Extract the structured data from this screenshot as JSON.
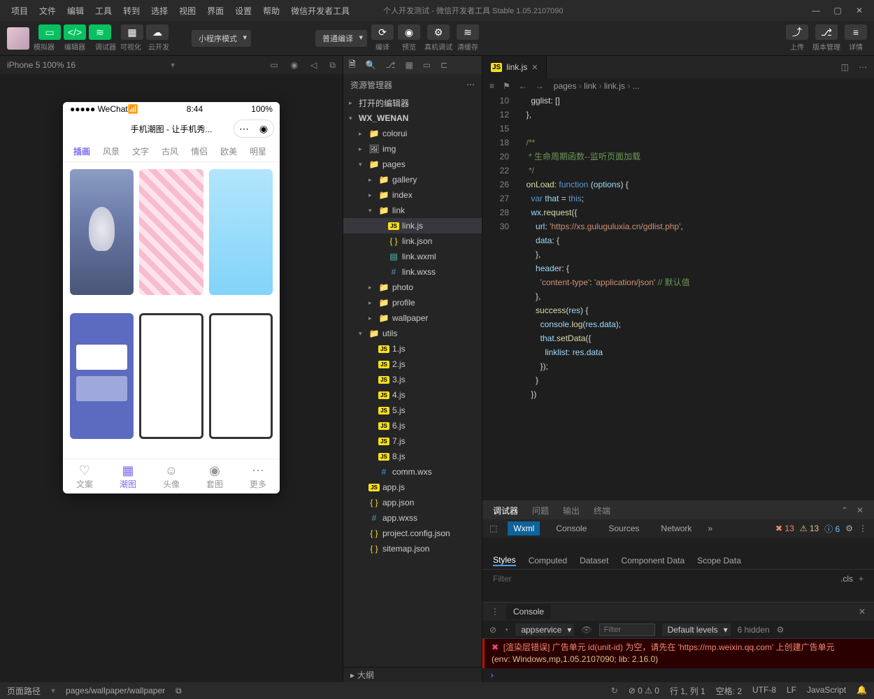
{
  "titlebar": {
    "menus": [
      "项目",
      "文件",
      "编辑",
      "工具",
      "转到",
      "选择",
      "视图",
      "界面",
      "设置",
      "帮助",
      "微信开发者工具"
    ],
    "title": "个人开发测试 - 微信开发者工具 Stable 1.05.2107090"
  },
  "toolbar": {
    "groups": {
      "g1": [
        "模拟器",
        "编辑器",
        "调试器"
      ],
      "g2": [
        "可视化",
        "云开发"
      ],
      "mode_select": "小程序模式",
      "compile_select": "普通编译",
      "compile": "编译",
      "preview": "预览",
      "remote": "真机调试",
      "cache": "清缓存",
      "upload": "上传",
      "version": "版本管理",
      "details": "详情"
    }
  },
  "simulator": {
    "device": "iPhone 5 100% 16",
    "status": {
      "carrier": "●●●●● WeChat",
      "wifi": "📶",
      "time": "8:44",
      "battery": "100%"
    },
    "app_title": "手机潮图 - 让手机秀...",
    "tabs": [
      "插画",
      "风景",
      "文字",
      "古风",
      "情侣",
      "欧美",
      "明星"
    ],
    "nav": [
      {
        "icon": "♡",
        "label": "文案"
      },
      {
        "icon": "▦",
        "label": "潮图"
      },
      {
        "icon": "☺",
        "label": "头像"
      },
      {
        "icon": "◉",
        "label": "套图"
      },
      {
        "icon": "⋯",
        "label": "更多"
      }
    ]
  },
  "explorer": {
    "title": "资源管理器",
    "open_editors": "打开的编辑器",
    "project": "WX_WENAN",
    "tree": [
      {
        "indent": 22,
        "chev": "▸",
        "icon": "folder",
        "label": "colorui"
      },
      {
        "indent": 22,
        "chev": "▸",
        "icon": "img",
        "label": "img"
      },
      {
        "indent": 22,
        "chev": "▾",
        "icon": "folder",
        "label": "pages"
      },
      {
        "indent": 36,
        "chev": "▸",
        "icon": "folder",
        "label": "gallery"
      },
      {
        "indent": 36,
        "chev": "▸",
        "icon": "folder",
        "label": "index"
      },
      {
        "indent": 36,
        "chev": "▾",
        "icon": "folder",
        "label": "link"
      },
      {
        "indent": 50,
        "chev": "",
        "icon": "js",
        "label": "link.js",
        "selected": true
      },
      {
        "indent": 50,
        "chev": "",
        "icon": "json",
        "label": "link.json"
      },
      {
        "indent": 50,
        "chev": "",
        "icon": "wxml",
        "label": "link.wxml"
      },
      {
        "indent": 50,
        "chev": "",
        "icon": "wxss",
        "label": "link.wxss"
      },
      {
        "indent": 36,
        "chev": "▸",
        "icon": "folder",
        "label": "photo"
      },
      {
        "indent": 36,
        "chev": "▸",
        "icon": "folder",
        "label": "profile"
      },
      {
        "indent": 36,
        "chev": "▸",
        "icon": "folder",
        "label": "wallpaper"
      },
      {
        "indent": 22,
        "chev": "▾",
        "icon": "folder",
        "label": "utils"
      },
      {
        "indent": 36,
        "chev": "",
        "icon": "js",
        "label": "1.js"
      },
      {
        "indent": 36,
        "chev": "",
        "icon": "js",
        "label": "2.js"
      },
      {
        "indent": 36,
        "chev": "",
        "icon": "js",
        "label": "3.js"
      },
      {
        "indent": 36,
        "chev": "",
        "icon": "js",
        "label": "4.js"
      },
      {
        "indent": 36,
        "chev": "",
        "icon": "js",
        "label": "5.js"
      },
      {
        "indent": 36,
        "chev": "",
        "icon": "js",
        "label": "6.js"
      },
      {
        "indent": 36,
        "chev": "",
        "icon": "js",
        "label": "7.js"
      },
      {
        "indent": 36,
        "chev": "",
        "icon": "js",
        "label": "8.js"
      },
      {
        "indent": 36,
        "chev": "",
        "icon": "wxss",
        "label": "comm.wxs"
      },
      {
        "indent": 22,
        "chev": "",
        "icon": "js",
        "label": "app.js"
      },
      {
        "indent": 22,
        "chev": "",
        "icon": "json",
        "label": "app.json"
      },
      {
        "indent": 22,
        "chev": "",
        "icon": "wxss",
        "label": "app.wxss"
      },
      {
        "indent": 22,
        "chev": "",
        "icon": "json",
        "label": "project.config.json"
      },
      {
        "indent": 22,
        "chev": "",
        "icon": "json",
        "label": "sitemap.json"
      }
    ],
    "outline": "大纲"
  },
  "editor": {
    "tab": "link.js",
    "breadcrumb": [
      "pages",
      "link",
      "link.js",
      "..."
    ],
    "code": {
      "lines": [
        {
          "n": "",
          "html": "    gglist: []"
        },
        {
          "n": "10",
          "html": "  },"
        },
        {
          "n": "",
          "html": ""
        },
        {
          "n": "12",
          "html": "  <span class=c-green>/**</span>"
        },
        {
          "n": "",
          "html": "<span class=c-green>   * 生命周期函数--监听页面加载</span>"
        },
        {
          "n": "",
          "html": "<span class=c-green>   */</span>"
        },
        {
          "n": "15",
          "html": "  <span class=c-yellow>onLoad</span>: <span class=c-blue>function</span> (<span class=c-lblue>options</span>) {"
        },
        {
          "n": "",
          "html": "    <span class=c-blue>var</span> <span class=c-lblue>that</span> = <span class=c-blue>this</span>;"
        },
        {
          "n": "",
          "html": "    <span class=c-lblue>wx</span>.<span class=c-yellow>request</span>({"
        },
        {
          "n": "18",
          "html": "      <span class=c-lblue>url</span>: <span class=c-orange>'https://xs.guluguluxia.cn/gdlist.php'</span>,"
        },
        {
          "n": "",
          "html": "      <span class=c-lblue>data</span>: {"
        },
        {
          "n": "20",
          "html": "      },"
        },
        {
          "n": "",
          "html": "      <span class=c-lblue>header</span>: {"
        },
        {
          "n": "22",
          "html": "        <span class=c-orange>'content-type'</span>: <span class=c-orange>'application/json'</span> <span class=c-green>// 默认值</span>"
        },
        {
          "n": "",
          "html": "      },"
        },
        {
          "n": "",
          "html": "      <span class=c-yellow>success</span>(<span class=c-lblue>res</span>) {"
        },
        {
          "n": "",
          "html": "        <span class=c-lblue>console</span>.<span class=c-yellow>log</span>(<span class=c-lblue>res</span>.<span class=c-lblue>data</span>);"
        },
        {
          "n": "26",
          "html": "        <span class=c-lblue>that</span>.<span class=c-yellow>setData</span>({"
        },
        {
          "n": "27",
          "html": "          <span class=c-lblue>linklist</span>: <span class=c-lblue>res</span>.<span class=c-lblue>data</span>"
        },
        {
          "n": "28",
          "html": "        });"
        },
        {
          "n": "",
          "html": "      }"
        },
        {
          "n": "30",
          "html": "    })"
        }
      ]
    }
  },
  "debugger": {
    "tabs": [
      "调试器",
      "问题",
      "输出",
      "终端"
    ],
    "tools": [
      "Wxml",
      "Console",
      "Sources",
      "Network"
    ],
    "badges": {
      "err": "13",
      "warn": "13",
      "info": "6"
    },
    "style_tabs": [
      "Styles",
      "Computed",
      "Dataset",
      "Component Data",
      "Scope Data"
    ],
    "filter_ph": "Filter",
    "cls": ".cls",
    "console": {
      "title": "Console",
      "context": "appservice",
      "levels": "Default levels",
      "hidden": "6 hidden",
      "error": "[渲染层错误] 广告单元 id(unit-id) 为空，请先在 'https://mp.weixin.qq.com' 上创建广告单元",
      "env": "(env: Windows,mp,1.05.2107090; lib: 2.16.0)"
    }
  },
  "statusbar": {
    "path_label": "页面路径",
    "path": "pages/wallpaper/wallpaper",
    "warn": "0",
    "err": "0",
    "line": "行 1, 列 1",
    "spaces": "空格: 2",
    "enc": "UTF-8",
    "eol": "LF",
    "lang": "JavaScript"
  }
}
